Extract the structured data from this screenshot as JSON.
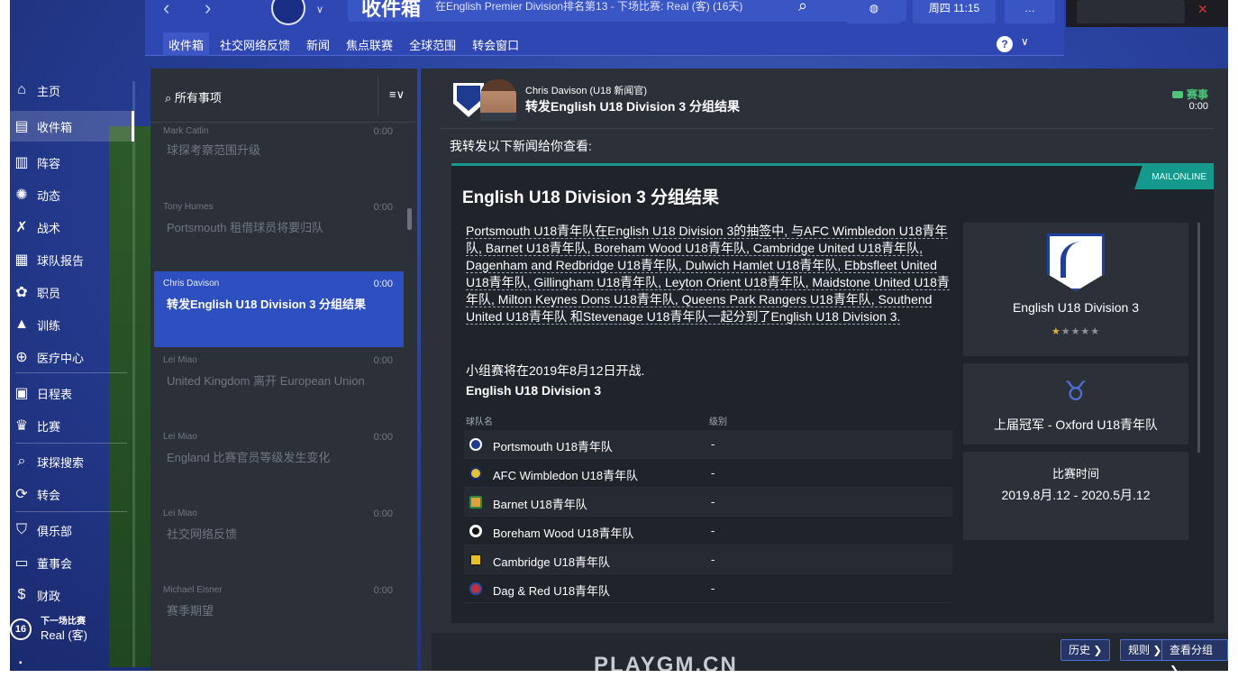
{
  "topbar": {
    "inbox_title": "收件箱",
    "inbox_subtitle": "在English Premier Division排名第13 - 下场比赛: Real (客) (16天)",
    "date_label": "周四 11:15",
    "tabs": [
      {
        "label": "收件箱",
        "active": true
      },
      {
        "label": "社交网络反馈"
      },
      {
        "label": "新闻"
      },
      {
        "label": "焦点联赛"
      },
      {
        "label": "全球范围"
      },
      {
        "label": "转会窗口"
      }
    ],
    "help_label": "?"
  },
  "sidebar": {
    "items": [
      {
        "label": "主页",
        "icon": "home-icon"
      },
      {
        "label": "收件箱",
        "icon": "inbox-icon",
        "active": true
      },
      {
        "label": "阵容",
        "icon": "squad-icon"
      },
      {
        "label": "动态",
        "icon": "dynamics-icon"
      },
      {
        "label": "战术",
        "icon": "tactics-icon"
      },
      {
        "label": "球队报告",
        "icon": "report-icon"
      },
      {
        "label": "职员",
        "icon": "staff-icon"
      },
      {
        "label": "训练",
        "icon": "training-icon"
      },
      {
        "label": "医疗中心",
        "icon": "medical-icon"
      },
      {
        "label": "日程表",
        "icon": "calendar-icon"
      },
      {
        "label": "比赛",
        "icon": "trophy-icon"
      },
      {
        "label": "球探搜索",
        "icon": "search-icon"
      },
      {
        "label": "转会",
        "icon": "transfer-icon"
      },
      {
        "label": "俱乐部",
        "icon": "club-icon"
      },
      {
        "label": "董事会",
        "icon": "board-icon"
      },
      {
        "label": "财政",
        "icon": "finance-icon"
      }
    ],
    "next_match": {
      "day": "16",
      "label": "下一场比赛",
      "opponent": "Real (客)"
    }
  },
  "list": {
    "filter_label": "所有事项",
    "messages": [
      {
        "from": "Mark Catlin",
        "time": "0:00",
        "subject": "球探考察范围升级"
      },
      {
        "from": "Tony Humes",
        "time": "0:00",
        "subject": "Portsmouth 租借球员将要归队"
      },
      {
        "from": "Chris Davison",
        "time": "0:00",
        "subject": "转发English U18 Division 3 分组结果",
        "active": true
      },
      {
        "from": "Lei Miao",
        "time": "0:00",
        "subject": "United Kingdom 离开 European Union"
      },
      {
        "from": "Lei Miao",
        "time": "0:00",
        "subject": "England 比赛官员等级发生变化"
      },
      {
        "from": "Lei Miao",
        "time": "0:00",
        "subject": "社交网络反馈"
      },
      {
        "from": "Michael Eisner",
        "time": "0:00",
        "subject": "赛季期望"
      }
    ]
  },
  "message": {
    "sender": "Chris Davison  (U18 新闻官)",
    "subject": "转发English U18 Division 3 分组结果",
    "tag": "赛事",
    "tag_time": "0:00",
    "intro": "我转发以下新闻给你查看:",
    "article": {
      "title": "English U18 Division 3 分组结果",
      "source": "MAILONLINE",
      "body": "Portsmouth U18青年队在English U18 Division 3的抽签中, 与AFC Wimbledon U18青年队, Barnet U18青年队, Boreham Wood U18青年队, Cambridge United U18青年队, Dagenham and Redbridge U18青年队, Dulwich Hamlet U18青年队, Ebbsfleet United U18青年队, Gillingham U18青年队, Leyton Orient U18青年队, Maidstone United U18青年队, Milton Keynes Dons U18青年队, Queens Park Rangers U18青年队, Southend United U18青年队 和Stevenage U18青年队一起分到了English U18 Division 3.",
      "start_line": "小组赛将在2019年8月12日开战.",
      "table_title": "English U18 Division 3",
      "col_team": "球队名",
      "col_level": "级别",
      "teams": [
        {
          "name": "Portsmouth U18青年队",
          "level": "-",
          "color": "#1d3c8f"
        },
        {
          "name": "AFC Wimbledon U18青年队",
          "level": "-",
          "color": "#e2c33c"
        },
        {
          "name": "Barnet U18青年队",
          "level": "-",
          "color": "#e0a040"
        },
        {
          "name": "Boreham Wood U18青年队",
          "level": "-",
          "color": "#ffffff"
        },
        {
          "name": "Cambridge U18青年队",
          "level": "-",
          "color": "#e8c02a"
        },
        {
          "name": "Dag & Red U18青年队",
          "level": "-",
          "color": "#c0303a"
        }
      ]
    },
    "league_card": {
      "name": "English U18 Division 3",
      "stars": "★★★★★",
      "rating": 0.5
    },
    "champion_card": {
      "label": "上届冠军 - Oxford U18青年队"
    },
    "period_card": {
      "label": "比赛时间",
      "value": "2019.8月.12 - 2020.5月.12"
    },
    "buttons": {
      "history": "历史 ❯",
      "rules": "规则 ❯",
      "groups": "查看分组 ❯"
    }
  },
  "watermark": "PLAYGM.CN"
}
